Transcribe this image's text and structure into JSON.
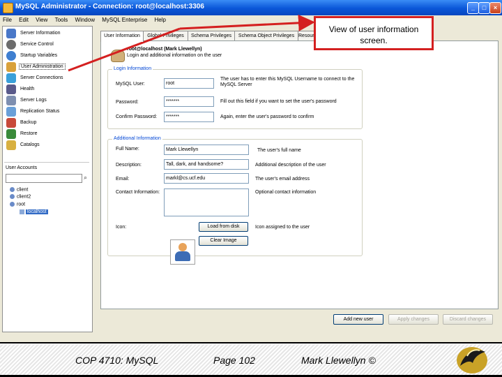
{
  "window": {
    "title": "MySQL Administrator - Connection: root@localhost:3306",
    "controls": [
      "_",
      "□",
      "×"
    ]
  },
  "menu": [
    "File",
    "Edit",
    "View",
    "Tools",
    "Window",
    "MySQL Enterprise",
    "Help"
  ],
  "nav": [
    {
      "label": "Server Information",
      "icon": "server-info-icon",
      "color": "#4a78c8"
    },
    {
      "label": "Service Control",
      "icon": "service-control-icon",
      "color": "#6c6c6c"
    },
    {
      "label": "Startup Variables",
      "icon": "startup-variables-icon",
      "color": "#3f7fd0"
    },
    {
      "label": "User Administration",
      "icon": "user-admin-icon",
      "color": "#d9a13a"
    },
    {
      "label": "Server Connections",
      "icon": "server-connections-icon",
      "color": "#3aa0d9"
    },
    {
      "label": "Health",
      "icon": "health-icon",
      "color": "#5a5a8a"
    },
    {
      "label": "Server Logs",
      "icon": "server-logs-icon",
      "color": "#7e8fb0"
    },
    {
      "label": "Replication Status",
      "icon": "replication-icon",
      "color": "#6aa0d8"
    },
    {
      "label": "Backup",
      "icon": "backup-icon",
      "color": "#c84a3a"
    },
    {
      "label": "Restore",
      "icon": "restore-icon",
      "color": "#3a8a3a"
    },
    {
      "label": "Catalogs",
      "icon": "catalogs-icon",
      "color": "#d8b040"
    }
  ],
  "user_accounts": {
    "title": "User Accounts",
    "users": [
      "client",
      "client2",
      "root"
    ],
    "selected_host": "localhost"
  },
  "tabs": [
    "User Information",
    "Global Privileges",
    "Schema Privileges",
    "Schema Object Privileges",
    "Resources"
  ],
  "user_header": {
    "name": "root@localhost (Mark Llewellyn)",
    "description": "Login and additional information on the user"
  },
  "login_info": {
    "title": "Login Information",
    "mysql_user_label": "MySQL User:",
    "mysql_user_value": "root",
    "mysql_user_hint": "The user has to enter this MySQL Username to connect to the MySQL Server",
    "password_label": "Password:",
    "password_value": "*******",
    "password_hint": "Fill out this field if you want to set the user's password",
    "confirm_label": "Confirm Password:",
    "confirm_value": "*******",
    "confirm_hint": "Again, enter the user's password to confirm"
  },
  "additional_info": {
    "title": "Additional Information",
    "fullname_label": "Full Name:",
    "fullname_value": "Mark Llewellyn",
    "fullname_hint": "The user's full name",
    "description_label": "Description:",
    "description_value": "Tall, dark, and handsome?",
    "description_hint": "Additional description of the user",
    "email_label": "Email:",
    "email_value": "markl@cs.ucf.edu",
    "email_hint": "The user's email address",
    "contact_label": "Contact Information:",
    "contact_hint": "Optional contact information",
    "icon_label": "Icon:",
    "icon_hint": "Icon assigned to the user",
    "load_button": "Load from disk",
    "clear_button": "Clear Image"
  },
  "bottom_buttons": {
    "add_user": "Add new user",
    "apply": "Apply changes",
    "discard": "Discard changes"
  },
  "callout": "View of user information screen.",
  "footer": {
    "course": "COP 4710: MySQL",
    "page": "Page 102",
    "author": "Mark Llewellyn ©"
  },
  "colors": {
    "callout_border": "#d42020",
    "titlebar": "#0a56d8",
    "selection": "#316ac5"
  }
}
